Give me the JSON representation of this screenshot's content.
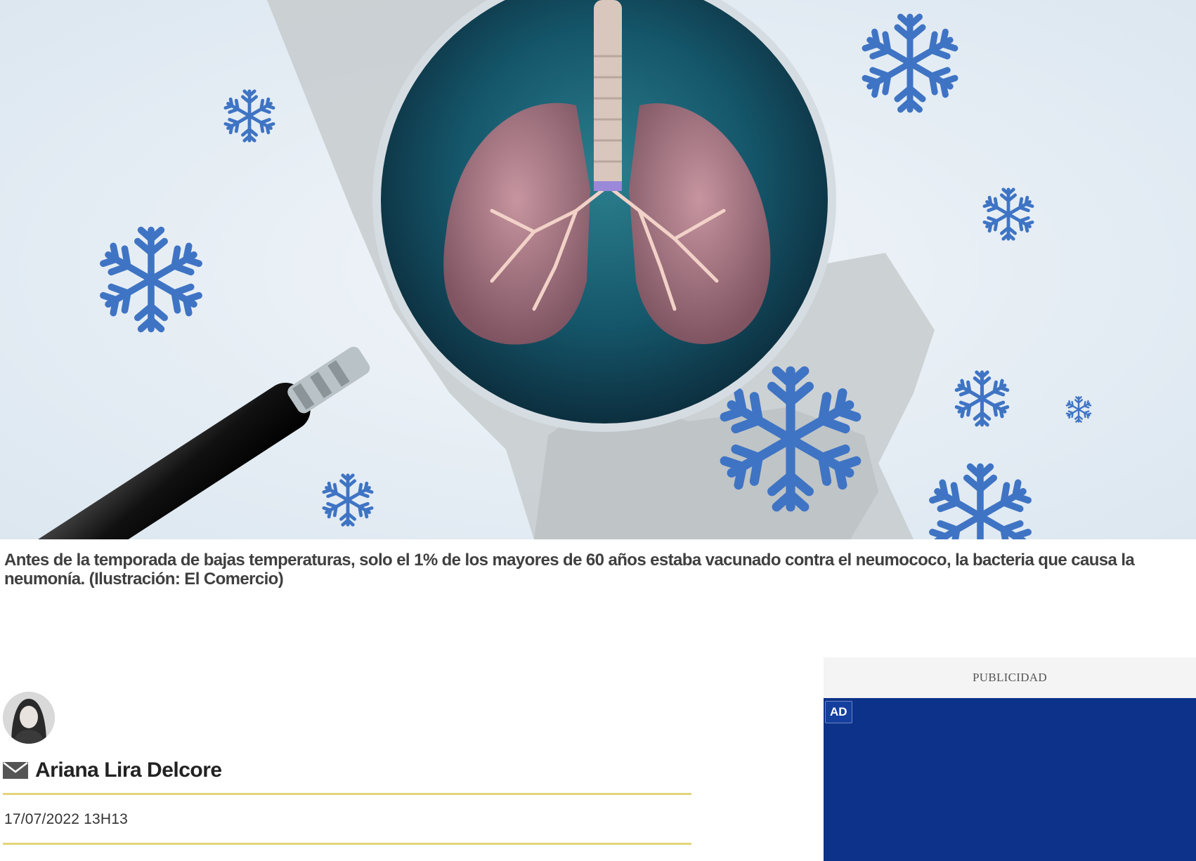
{
  "hero": {
    "image_name": "lungs-magnifier-snowflakes-illustration",
    "caption": "Antes de la temporada de bajas temperaturas, solo el 1% de los mayores de 60 años estaba vacunado contra el neumococo, la bacteria que causa la neumonía. (Ilustración: El Comercio)"
  },
  "author": {
    "name": "Ariana Lira Delcore",
    "avatar_icon": "author-avatar",
    "contact_icon": "mail-icon"
  },
  "article": {
    "date": "17/07/2022 13H13"
  },
  "ad": {
    "label": "PUBLICIDAD",
    "badge": "AD"
  },
  "colors": {
    "rule": "#e3d57a",
    "ad_background": "#0c3289",
    "snowflake": "#3f74c4",
    "caption_text": "#3f3f3f"
  }
}
